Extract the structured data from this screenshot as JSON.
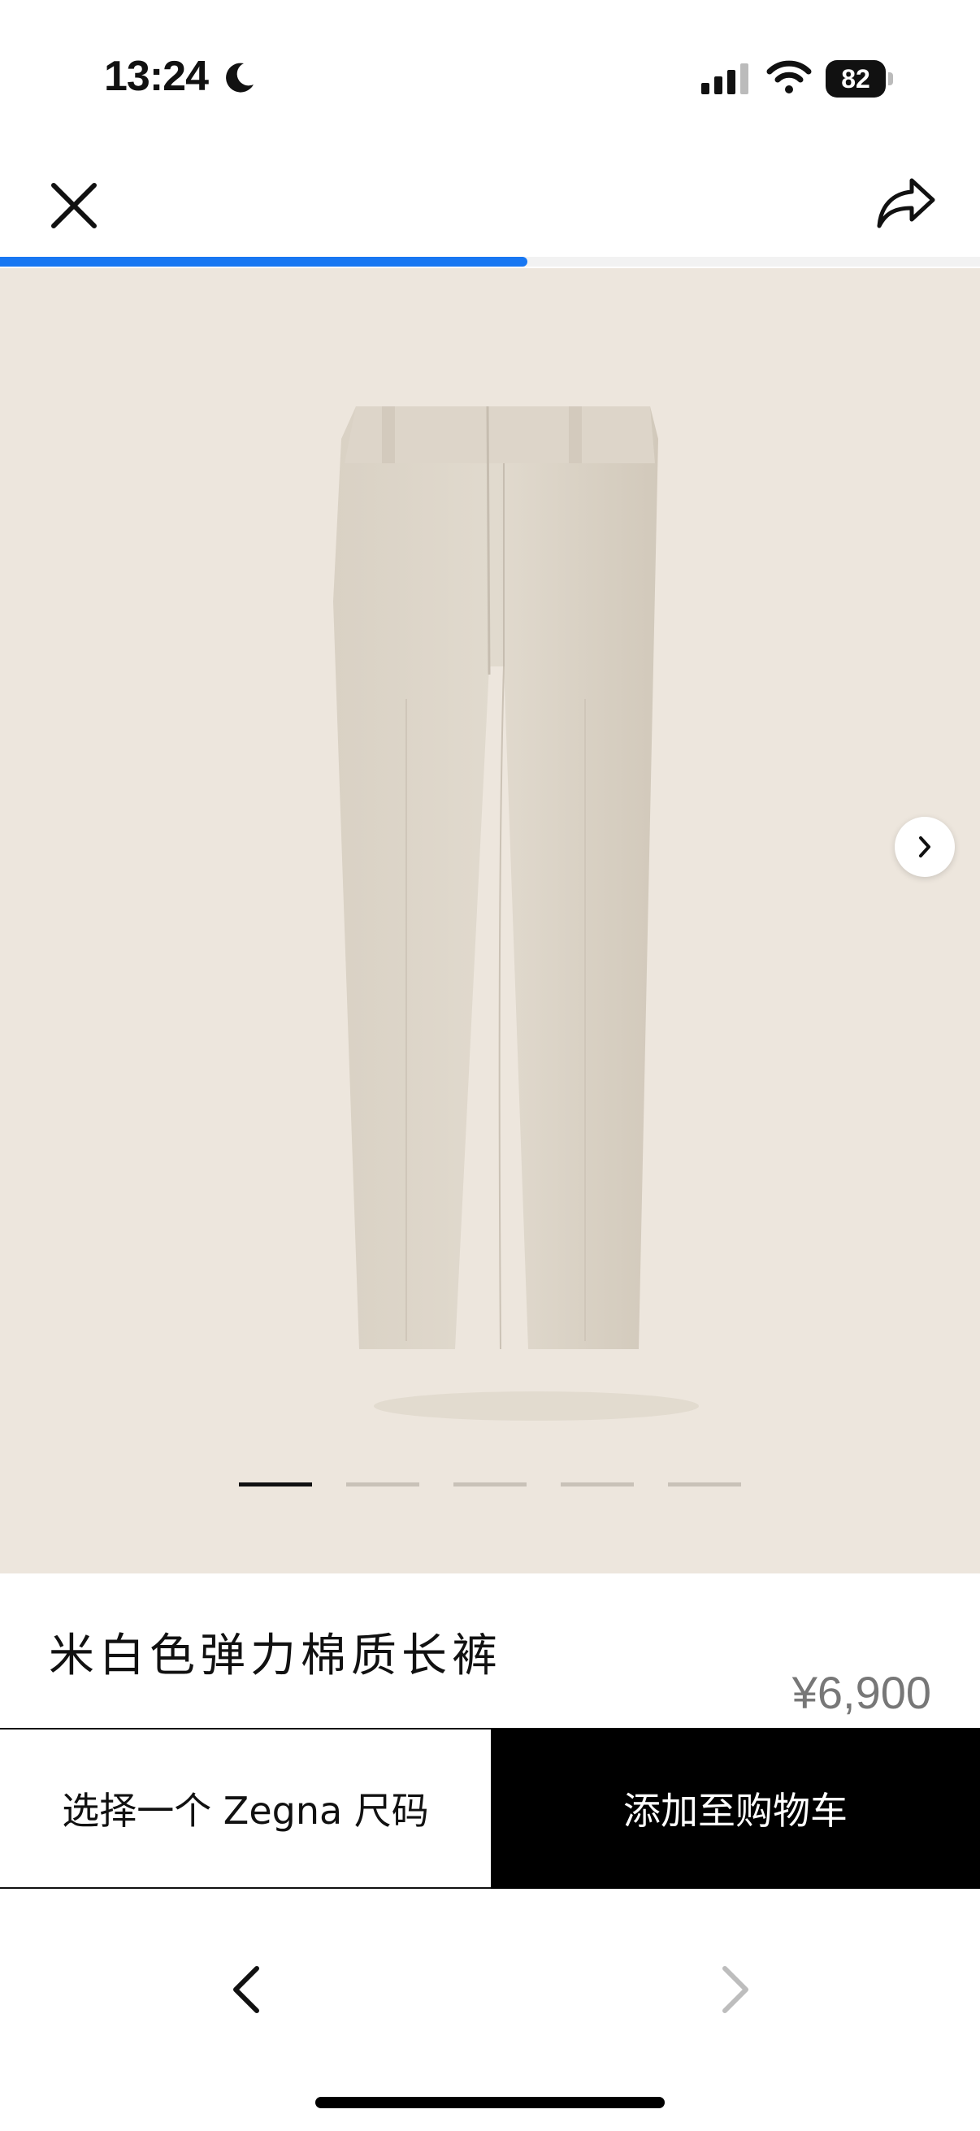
{
  "status_bar": {
    "time": "13:24",
    "battery": "82"
  },
  "nav": {
    "progress_fraction": 0.538
  },
  "gallery": {
    "image_count": 5,
    "active_index": 0
  },
  "product": {
    "title": "米白色弹力棉质长裤",
    "price": "¥6,900"
  },
  "actions": {
    "size_label": "选择一个 Zegna 尺码",
    "cart_label": "添加至购物车"
  },
  "colors": {
    "accent": "#1877f2",
    "gallery_bg": "#ede6dd",
    "cart_bg": "#000000"
  }
}
